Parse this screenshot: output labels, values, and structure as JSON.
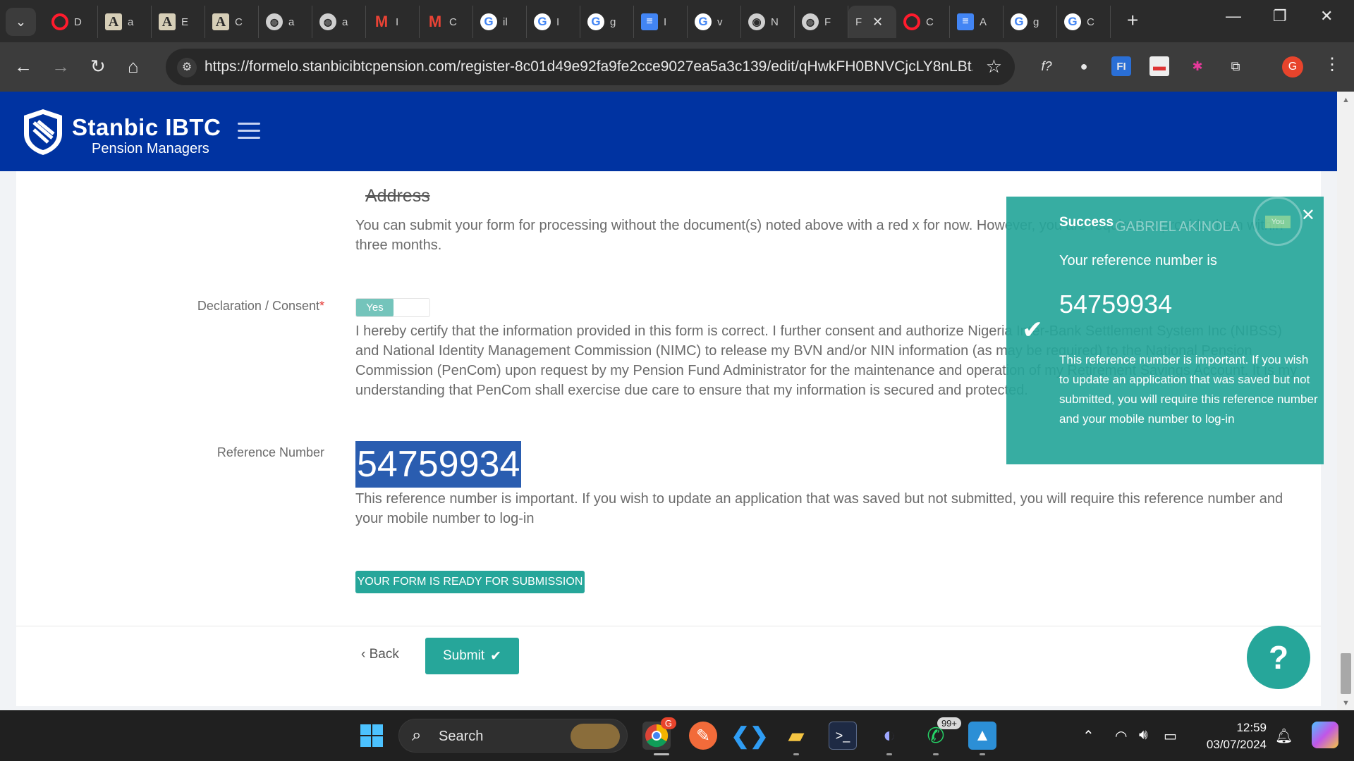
{
  "browser": {
    "tabs": [
      {
        "icon": "opera-icon",
        "title": "D"
      },
      {
        "icon": "anthropic-icon",
        "title": "a"
      },
      {
        "icon": "anthropic-icon",
        "title": "E"
      },
      {
        "icon": "anthropic-icon",
        "title": "C"
      },
      {
        "icon": "globe-icon",
        "title": "a"
      },
      {
        "icon": "globe-icon",
        "title": "a"
      },
      {
        "icon": "gmail-icon",
        "title": "I"
      },
      {
        "icon": "gmail-icon",
        "title": "C"
      },
      {
        "icon": "google-icon",
        "title": "il"
      },
      {
        "icon": "google-icon",
        "title": "I"
      },
      {
        "icon": "google-icon",
        "title": "g"
      },
      {
        "icon": "docs-icon",
        "title": "I"
      },
      {
        "icon": "google-icon",
        "title": "v"
      },
      {
        "icon": "github-icon",
        "title": "N"
      },
      {
        "icon": "globe-icon",
        "title": "F"
      },
      {
        "icon": "none",
        "title": "F",
        "active": true
      },
      {
        "icon": "opera-icon",
        "title": "C"
      },
      {
        "icon": "docs-icon",
        "title": "A"
      },
      {
        "icon": "google-icon",
        "title": "g"
      },
      {
        "icon": "google-icon",
        "title": "C"
      }
    ],
    "url": "https://formelo.stanbicibtcpension.com/register-8c01d49e92fa9fe2cce9027ea5a3c139/edit/qHwkFH0BNVCjcLY8nLBt...",
    "profile_initial": "G",
    "ext_f_label": "f?",
    "ext_fi_label": "FI"
  },
  "site": {
    "brand_title": "Stanbic IBTC",
    "brand_subtitle": "Pension Managers"
  },
  "form": {
    "address_heading": "Address",
    "missing_docs_note": "You can submit your form for processing without the document(s) noted above with a red x for now. However, you are required to provide them within three months.",
    "declaration_label": "Declaration / Consent",
    "required_mark": "*",
    "toggle_on_label": "Yes",
    "declaration_text": "I hereby certify that the information provided in this form is correct. I further consent and authorize Nigeria Inter-Bank Settlement System Inc (NIBSS) and National Identity Management Commission (NIMC) to release my BVN and/or NIN information (as may be required) to the National Pension Commission (PenCom) upon request by my Pension Fund Administrator for the maintenance and operation of my Retirement Savings Account. It is my understanding that PenCom shall exercise due care to ensure that my information is secured and protected.",
    "reference_label": "Reference Number",
    "reference_number": "54759934",
    "reference_note": "This reference number is important. If you wish to update an application that was saved but not submitted, you will require this reference number and your mobile number to log-in",
    "ready_badge": "YOUR FORM IS READY FOR SUBMISSION",
    "back_label": "Back",
    "submit_label": "Submit",
    "help_label": "?"
  },
  "toast": {
    "title": "Success",
    "user_name": "GABRIEL AKINOLA",
    "avatar_text": "You",
    "line1": "Your reference number is",
    "number": "54759934",
    "body": "This reference number is important. If you wish to update an application that was saved but not submitted, you will require this reference number and your mobile number to log-in"
  },
  "taskbar": {
    "search_label": "Search",
    "whatsapp_badge": "99+",
    "chrome_badge": "G",
    "time": "12:59",
    "date": "03/07/2024"
  },
  "colors": {
    "brand_blue": "#0033a1",
    "teal": "#26a69a",
    "selection_blue": "#2a5db0"
  }
}
